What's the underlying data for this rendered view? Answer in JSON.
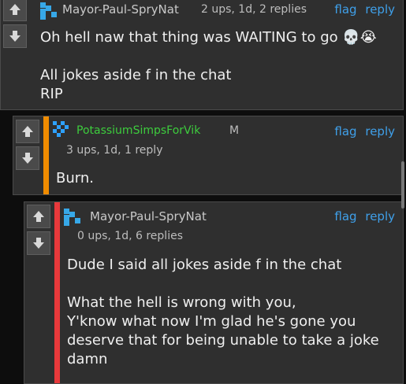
{
  "comments": [
    {
      "username": "Mayor-Paul-SpryNat",
      "username_color": "#c9c9c9",
      "meta": "2 ups, 1d, 2 replies",
      "flag": "flag",
      "reply": "reply",
      "line1": "Oh hell naw that thing was WAITING to go",
      "emojis": "💀😭",
      "line2": "All jokes aside f in the chat",
      "line3": "RIP"
    },
    {
      "username": "PotassiumSimpsForVik",
      "username_color": "#3dcc3d",
      "badge": "M",
      "meta": "3 ups, 1d, 1 reply",
      "flag": "flag",
      "reply": "reply",
      "line1": "Burn.",
      "stripe_color": "#f08c00"
    },
    {
      "username": "Mayor-Paul-SpryNat",
      "username_color": "#c9c9c9",
      "meta": "0 ups, 1d, 6 replies",
      "flag": "flag",
      "reply": "reply",
      "line1": "Dude I said all jokes aside f in the chat",
      "line2": "What the hell is wrong with you,",
      "line3": "Y'know what now I'm glad he's gone you",
      "line4": "deserve that for being unable to take a joke",
      "line5": "damn",
      "stripe_color": "#e8393b"
    }
  ],
  "colors": {
    "link": "#3fa0ea",
    "panel": "#2f2f2f",
    "background": "#0d0d0d"
  },
  "icons": [
    "upvote-arrow-icon",
    "downvote-arrow-icon",
    "avatar-icon"
  ]
}
